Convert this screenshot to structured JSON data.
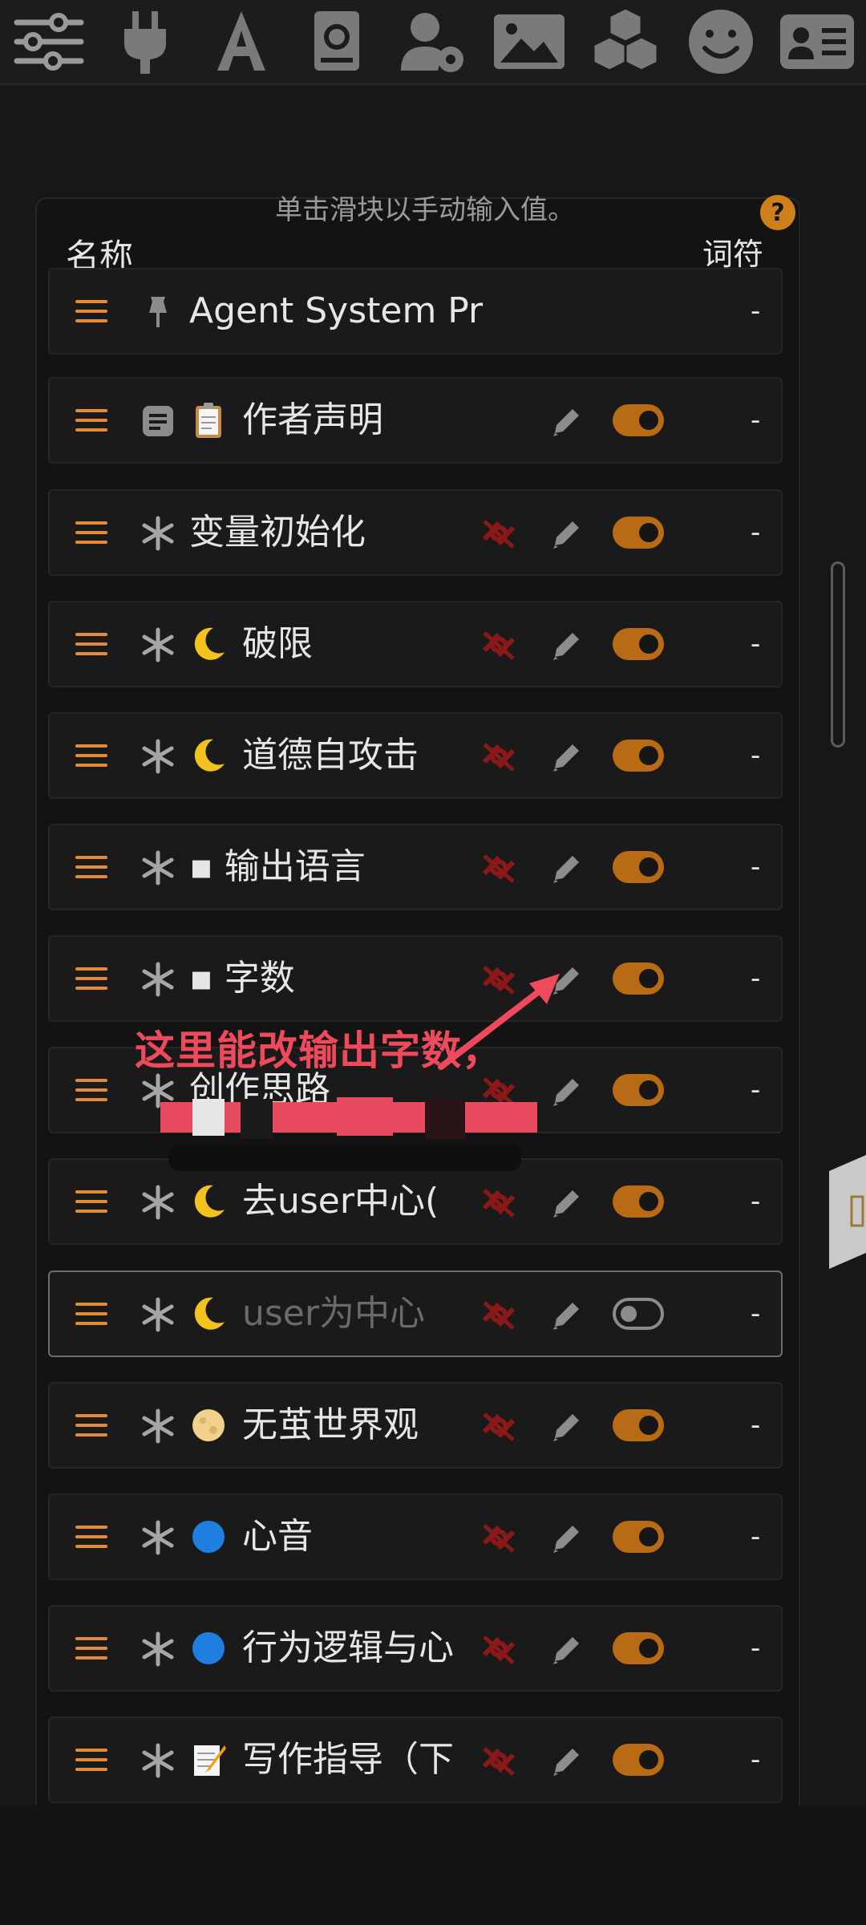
{
  "toolbar": {
    "icons": [
      "sliders-icon",
      "plug-icon",
      "font-icon",
      "book-icon",
      "user-settings-icon",
      "image-icon",
      "cubes-icon",
      "smiley-icon",
      "id-card-icon"
    ]
  },
  "panel": {
    "hint": "单击滑块以手动输入值。",
    "help": "?",
    "header_name": "名称",
    "header_tokens": "词符"
  },
  "rows": [
    {
      "label": "Agent System Pr",
      "tokens": "-",
      "kind": "pin",
      "emoji": "",
      "controls": false,
      "enabled": true
    },
    {
      "label": "作者声明",
      "tokens": "-",
      "kind": "note",
      "emoji": "clipboard",
      "controls": "edit",
      "enabled": true
    },
    {
      "label": "变量初始化",
      "tokens": "-",
      "kind": "asterisk",
      "emoji": "",
      "controls": "full",
      "enabled": true
    },
    {
      "label": "破限",
      "tokens": "-",
      "kind": "asterisk",
      "emoji": "moon",
      "controls": "full",
      "enabled": true
    },
    {
      "label": "道德自攻击",
      "tokens": "-",
      "kind": "asterisk",
      "emoji": "moon",
      "controls": "full",
      "enabled": true
    },
    {
      "label": "▪ 输出语言",
      "tokens": "-",
      "kind": "asterisk",
      "emoji": "",
      "controls": "full",
      "enabled": true
    },
    {
      "label": "▪ 字数",
      "tokens": "-",
      "kind": "asterisk",
      "emoji": "",
      "controls": "full",
      "enabled": true
    },
    {
      "label": "创作思路",
      "tokens": "-",
      "kind": "asterisk",
      "emoji": "",
      "controls": "full",
      "enabled": true
    },
    {
      "label": "去user中心(",
      "tokens": "-",
      "kind": "asterisk",
      "emoji": "moon",
      "controls": "full",
      "enabled": true
    },
    {
      "label": "user为中心",
      "tokens": "-",
      "kind": "asterisk",
      "emoji": "moon",
      "controls": "full",
      "enabled": false
    },
    {
      "label": "无茧世界观",
      "tokens": "-",
      "kind": "asterisk",
      "emoji": "fullmoon",
      "controls": "full",
      "enabled": true
    },
    {
      "label": "心音",
      "tokens": "-",
      "kind": "asterisk",
      "emoji": "bluecircle",
      "controls": "full",
      "enabled": true
    },
    {
      "label": "行为逻辑与心",
      "tokens": "-",
      "kind": "asterisk",
      "emoji": "bluecircle",
      "controls": "full",
      "enabled": true
    },
    {
      "label": "写作指导（下",
      "tokens": "-",
      "kind": "asterisk",
      "emoji": "memo",
      "controls": "full",
      "enabled": true
    }
  ],
  "annotation": {
    "text": "这里能改输出字数，",
    "color": "#ef4a5c"
  }
}
